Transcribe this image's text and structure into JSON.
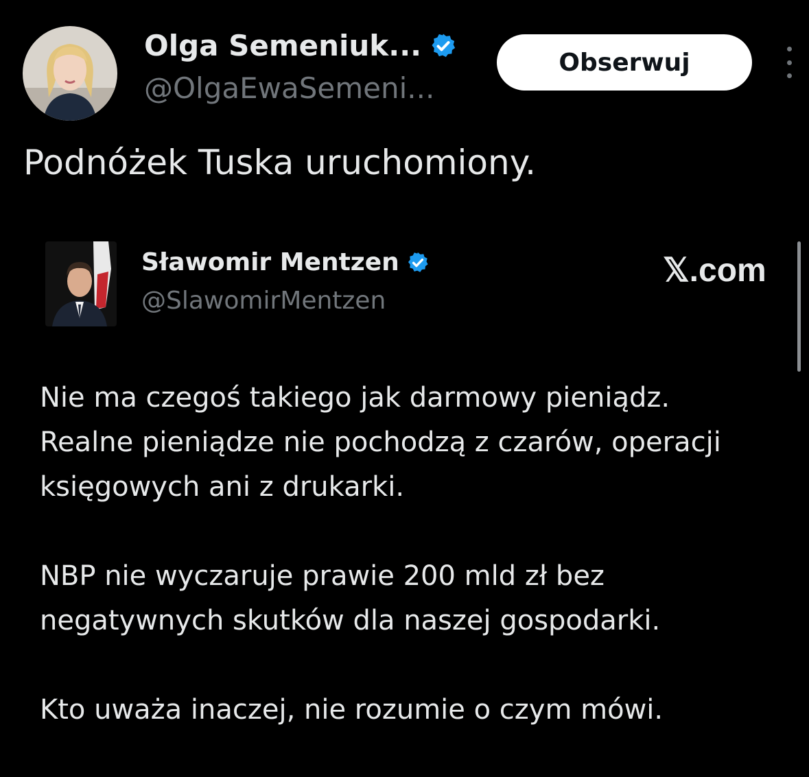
{
  "tweet": {
    "author": {
      "name": "Olga Semeniuk...",
      "handle": "@OlgaEwaSemeni...",
      "verified": true
    },
    "follow_label": "Obserwuj",
    "text": "Podnóżek Tuska uruchomiony."
  },
  "quoted_tweet": {
    "author": {
      "name": "Sławomir Mentzen",
      "handle": "@SlawomirMentzen",
      "verified": true
    },
    "source": "𝕏.com",
    "paragraphs": [
      "Nie ma czegoś takiego jak darmowy pieniądz.\nRealne pieniądze nie pochodzą z czarów, operacji\nksięgowych ani z drukarki.",
      "NBP nie wyczaruje prawie 200 mld zł bez\nnegatywnych skutków dla naszej gospodarki.",
      "Kto uważa inaczej, nie rozumie o czym mówi."
    ]
  },
  "colors": {
    "background": "#000000",
    "primary_text": "#e7e9ea",
    "secondary_text": "#71767b",
    "verified_badge": "#1d9bf0"
  }
}
